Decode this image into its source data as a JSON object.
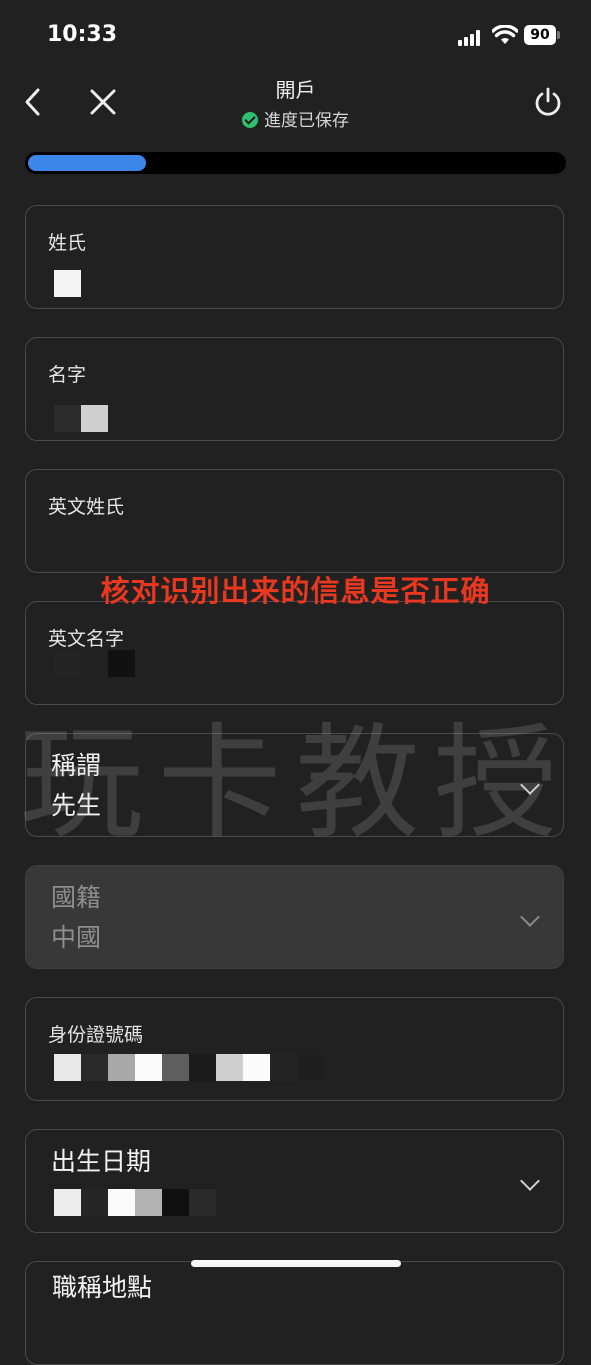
{
  "status_bar": {
    "time": "10:33",
    "battery": "90"
  },
  "header": {
    "title": "開戶",
    "save_status": "進度已保存"
  },
  "progress": {
    "fraction": 0.22
  },
  "fields": {
    "surname": {
      "label": "姓氏"
    },
    "given_name": {
      "label": "名字"
    },
    "english_surname": {
      "label": "英文姓氏"
    },
    "english_given_name": {
      "label": "英文名字"
    },
    "title": {
      "label": "稱謂",
      "value": "先生"
    },
    "nationality": {
      "label": "國籍",
      "value": "中國"
    },
    "id_number": {
      "label": "身份證號碼"
    },
    "birth_date": {
      "label": "出生日期"
    },
    "next_partial": {
      "label": "職稱地點"
    }
  },
  "annotation": "核对识别出来的信息是否正确",
  "watermark": "玩卡教授",
  "colors": {
    "accent": "#3b86e8",
    "saved_check": "#2fbf71",
    "annotation": "#e8381f",
    "background": "#212121"
  }
}
